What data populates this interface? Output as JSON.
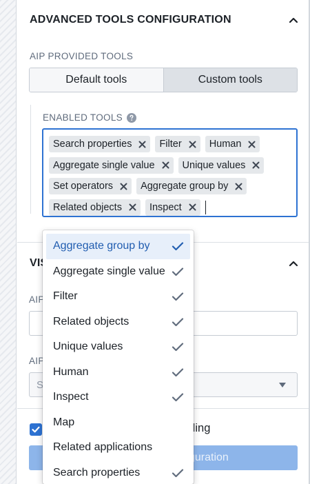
{
  "advanced_section": {
    "title": "ADVANCED TOOLS CONFIGURATION"
  },
  "aip_tools": {
    "label": "AIP PROVIDED TOOLS",
    "options": [
      "Default tools",
      "Custom tools"
    ],
    "selected": "Custom tools"
  },
  "enabled_tools": {
    "label": "ENABLED TOOLS",
    "tags": [
      [
        "Search properties",
        "Filter",
        "Human"
      ],
      [
        "Aggregate single value",
        "Unique values"
      ],
      [
        "Set operators",
        "Aggregate group by"
      ],
      [
        "Related objects",
        "Inspect"
      ]
    ]
  },
  "dropdown": {
    "options": [
      {
        "label": "Aggregate group by",
        "checked": true,
        "highlighted": true
      },
      {
        "label": "Aggregate single value",
        "checked": true,
        "highlighted": false
      },
      {
        "label": "Filter",
        "checked": true,
        "highlighted": false
      },
      {
        "label": "Related objects",
        "checked": true,
        "highlighted": false
      },
      {
        "label": "Unique values",
        "checked": true,
        "highlighted": false
      },
      {
        "label": "Human",
        "checked": true,
        "highlighted": false
      },
      {
        "label": "Inspect",
        "checked": true,
        "highlighted": false
      },
      {
        "label": "Map",
        "checked": false,
        "highlighted": false
      },
      {
        "label": "Related applications",
        "checked": false,
        "highlighted": false
      },
      {
        "label": "Search properties",
        "checked": true,
        "highlighted": false
      }
    ]
  },
  "visible_section": {
    "title_partial": "VIS"
  },
  "field_label_1": "AIP",
  "field_label_2": "AIP",
  "select_placeholder_partial": "S",
  "checkbox_label_partial": "ading",
  "primary_button_partial": "guration",
  "colors": {
    "accent": "#2d72d2",
    "highlight_bg": "#e7effa",
    "highlight_text": "#215db0",
    "tag_bg": "#e5e8eb",
    "check": "#5f6b7c",
    "disabled_button": "#8db5ea"
  }
}
